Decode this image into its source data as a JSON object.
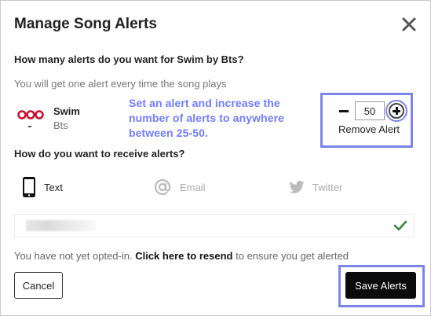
{
  "modal": {
    "title": "Manage Song Alerts",
    "question_count": "How many alerts do you want for Swim by Bts?",
    "subtext": "You will get one alert every time the song plays",
    "song": {
      "title": "Swim",
      "artist": "Bts"
    },
    "annotation": "Set an alert and increase the number of alerts to anywhere between 25-50.",
    "alert_count": {
      "value": "50",
      "remove_label": "Remove Alert"
    },
    "question_method": "How do you want to receive alerts?",
    "methods": [
      {
        "label": "Text",
        "icon": "phone-icon",
        "selected": true
      },
      {
        "label": "Email",
        "icon": "at-icon",
        "selected": false
      },
      {
        "label": "Twitter",
        "icon": "twitter-icon",
        "selected": false
      }
    ],
    "optin": {
      "prefix": "You have not yet opted-in.",
      "link": "Click here to resend",
      "suffix": "to ensure you get alerted"
    },
    "buttons": {
      "cancel": "Cancel",
      "save": "Save Alerts"
    }
  },
  "colors": {
    "highlight": "#7b85e8",
    "annotation_text": "#6f7cff",
    "check": "#2e8b3a",
    "primary_button": "#0b0b0b"
  }
}
